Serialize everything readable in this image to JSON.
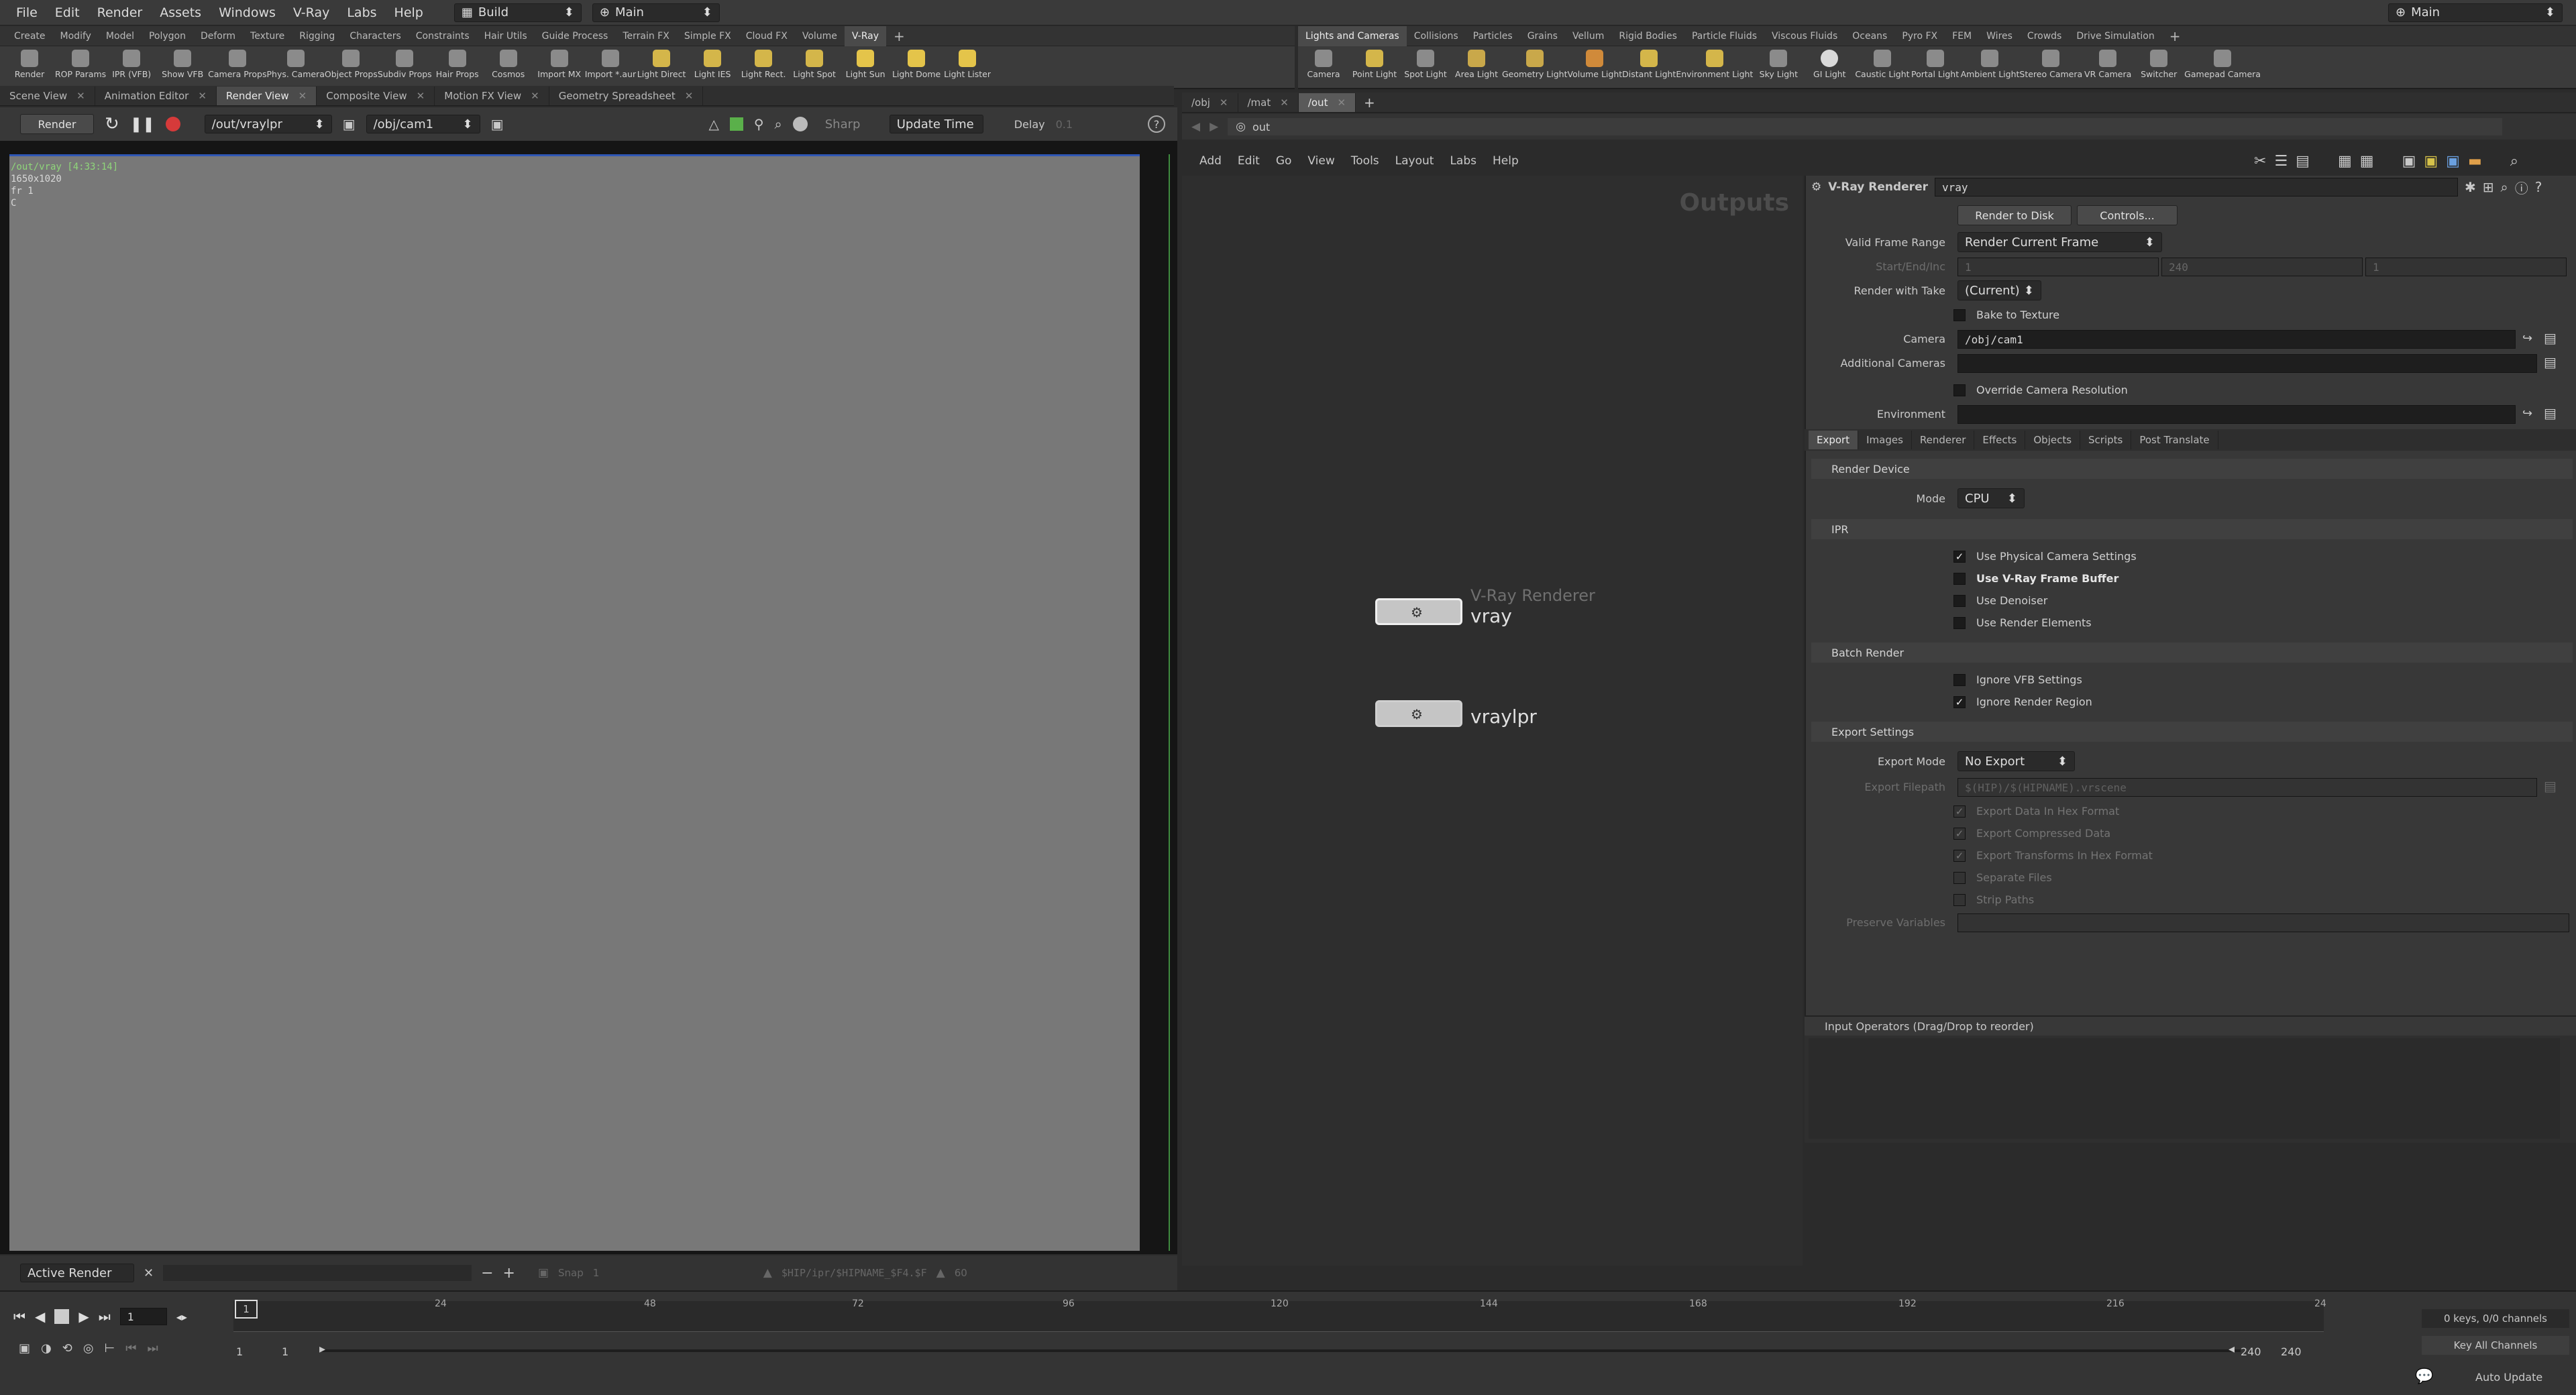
{
  "menubar": {
    "items": [
      "File",
      "Edit",
      "Render",
      "Assets",
      "Windows",
      "V-Ray",
      "Labs",
      "Help"
    ],
    "desktop": "Build",
    "context": "Main",
    "right_context": "Main"
  },
  "shelf_left": {
    "tabs": [
      "Create",
      "Modify",
      "Model",
      "Polygon",
      "Deform",
      "Texture",
      "Rigging",
      "Characters",
      "Constraints",
      "Hair Utils",
      "Guide Process",
      "Terrain FX",
      "Simple FX",
      "Cloud FX",
      "Volume",
      "V-Ray"
    ],
    "active": "V-Ray",
    "tools": [
      "Render",
      "ROP Params",
      "IPR (VFB)",
      "Show VFB",
      "Camera Props",
      "Phys. Camera",
      "Object Props",
      "Subdiv Props",
      "Hair Props",
      "Cosmos",
      "Import MX",
      "Import *.aur",
      "Light Direct",
      "Light IES",
      "Light Rect.",
      "Light Spot",
      "Light Sun",
      "Light Dome",
      "Light Lister"
    ]
  },
  "shelf_right": {
    "tabs": [
      "Lights and Cameras",
      "Collisions",
      "Particles",
      "Grains",
      "Vellum",
      "Rigid Bodies",
      "Particle Fluids",
      "Viscous Fluids",
      "Oceans",
      "Pyro FX",
      "FEM",
      "Wires",
      "Crowds",
      "Drive Simulation"
    ],
    "active": "Lights and Cameras",
    "tools": [
      "Camera",
      "Point Light",
      "Spot Light",
      "Area Light",
      "Geometry Light",
      "Volume Light",
      "Distant Light",
      "Environment Light",
      "Sky Light",
      "GI Light",
      "Caustic Light",
      "Portal Light",
      "Ambient Light",
      "Stereo Camera",
      "VR Camera",
      "Switcher",
      "Gamepad Camera"
    ]
  },
  "left_pane": {
    "tabs": [
      "Scene View",
      "Animation Editor",
      "Render View",
      "Composite View",
      "Motion FX View",
      "Geometry Spreadsheet"
    ],
    "active": "Render View",
    "toolbar": {
      "render": "Render",
      "rop": "/out/vraylpr",
      "camera": "/obj/cam1",
      "preview": "Sharp",
      "update": "Update Time",
      "delay": "Delay",
      "delay_value": "0.1"
    },
    "overlay": {
      "line1": "/out/vray  [4:33:14]",
      "line2": "1650x1020",
      "line3": "fr 1",
      "line4": "C"
    },
    "bottombar": {
      "active_render": "Active Render",
      "snap": "Snap",
      "snap_value": "1",
      "path": "$HIP/ipr/$HIPNAME_$F4.$F",
      "zoom": "60"
    }
  },
  "right_pane": {
    "tabs": [
      "/obj",
      "/mat",
      "/out"
    ],
    "active": "/out",
    "path": "out",
    "menu": [
      "Add",
      "Edit",
      "Go",
      "View",
      "Tools",
      "Layout",
      "Labs",
      "Help"
    ],
    "network_label": "Outputs",
    "nodes": [
      {
        "type": "V-Ray Renderer",
        "name": "vray"
      },
      {
        "type": "",
        "name": "vraylpr"
      }
    ]
  },
  "params": {
    "node_type": "V-Ray Renderer",
    "node_name": "vray",
    "render_to_disk": "Render to Disk",
    "controls": "Controls...",
    "valid_frame_range_label": "Valid Frame Range",
    "valid_frame_range": "Render Current Frame",
    "start_end_label": "Start/End/Inc",
    "start": "1",
    "end": "240",
    "inc": "1",
    "render_with_take_label": "Render with Take",
    "render_with_take": "(Current)",
    "bake": "Bake to Texture",
    "camera_label": "Camera",
    "camera": "/obj/cam1",
    "additional_cameras_label": "Additional Cameras",
    "override": "Override Camera Resolution",
    "environment_label": "Environment",
    "tabs": [
      "Export",
      "Images",
      "Renderer",
      "Effects",
      "Objects",
      "Scripts",
      "Post Translate"
    ],
    "active_tab": "Export",
    "render_device": "Render Device",
    "mode_label": "Mode",
    "mode": "CPU",
    "ipr": "IPR",
    "ipr_items": [
      {
        "label": "Use Physical Camera Settings",
        "checked": true
      },
      {
        "label": "Use V-Ray Frame Buffer",
        "checked": false
      },
      {
        "label": "Use Denoiser",
        "checked": false
      },
      {
        "label": "Use Render Elements",
        "checked": false
      }
    ],
    "batch": "Batch Render",
    "batch_items": [
      {
        "label": "Ignore VFB Settings",
        "checked": false
      },
      {
        "label": "Ignore Render Region",
        "checked": true
      }
    ],
    "export_settings": "Export Settings",
    "export_mode_label": "Export Mode",
    "export_mode": "No Export",
    "export_filepath_label": "Export Filepath",
    "export_filepath": "$(HIP)/$(HIPNAME).vrscene",
    "export_items": [
      {
        "label": "Export Data In Hex Format",
        "checked": true
      },
      {
        "label": "Export Compressed Data",
        "checked": true
      },
      {
        "label": "Export Transforms In Hex Format",
        "checked": true
      },
      {
        "label": "Separate Files",
        "checked": false
      },
      {
        "label": "Strip Paths",
        "checked": false
      }
    ],
    "preserve_label": "Preserve Variables",
    "input_operators": "Input Operators (Drag/Drop to reorder)"
  },
  "timeline": {
    "ticks": [
      "1",
      "24",
      "48",
      "72",
      "96",
      "120",
      "144",
      "168",
      "192",
      "216",
      "24"
    ],
    "frame": "1",
    "range_start": "1",
    "range_start2": "1",
    "range_end": "240",
    "range_end2": "240",
    "keys": "0 keys, 0/0 channels",
    "key_all": "Key All Channels",
    "auto_update": "Auto Update"
  }
}
